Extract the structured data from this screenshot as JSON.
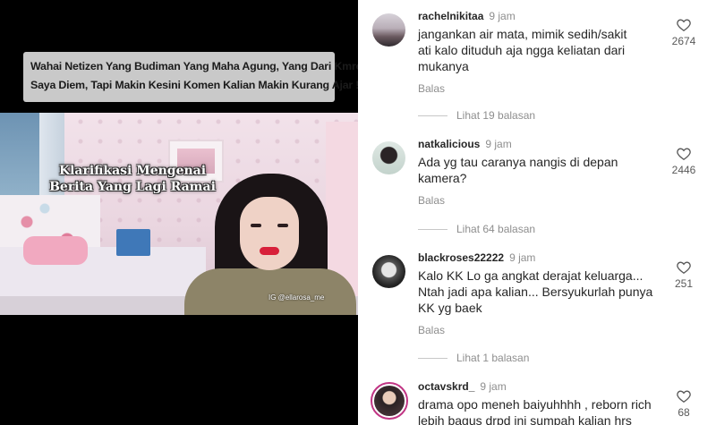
{
  "video": {
    "banner_lines": [
      "Wahai Netizen Yang Budiman Yang Maha Agung, Yang Dari Kmren",
      "Saya Diem, Tapi Makin Kesini Komen Kalian Makin Kurang Ajar !!!"
    ],
    "title_lines": [
      "Klarifikasi Mengenai",
      "Berita Yang Lagi Ramai"
    ],
    "watermark": "IG @ellarosa_me"
  },
  "comments": [
    {
      "username": "rachelnikitaa",
      "time": "9 jam",
      "text_lines": [
        "jangankan air mata, mimik sedih/sakit",
        "ati kalo dituduh aja ngga keliatan dari",
        "mukanya"
      ],
      "reply_label": "Balas",
      "likes": "2674",
      "view_replies": "Lihat 19 balasan"
    },
    {
      "username": "natkalicious",
      "time": "9 jam",
      "text_lines": [
        "Ada yg tau caranya nangis di depan",
        "kamera?"
      ],
      "reply_label": "Balas",
      "likes": "2446",
      "view_replies": "Lihat 64 balasan"
    },
    {
      "username": "blackroses22222",
      "time": "9 jam",
      "text_lines": [
        "Kalo KK Lo ga angkat derajat keluarga...",
        "Ntah jadi apa kalian... Bersyukurlah punya",
        "KK yg baek"
      ],
      "reply_label": "Balas",
      "likes": "251",
      "view_replies": "Lihat 1 balasan"
    },
    {
      "username": "octavskrd_",
      "time": "9 jam",
      "text_lines": [
        "drama opo meneh baiyuhhhh , reborn rich",
        "lebih bagus drpd ini sumpah kalian hrs"
      ],
      "likes": "68"
    }
  ],
  "icons": {
    "like": "heart-outline-icon"
  },
  "colors": {
    "text": "#262626",
    "secondary": "#8e8e8e",
    "story_ring": "#c13584"
  }
}
